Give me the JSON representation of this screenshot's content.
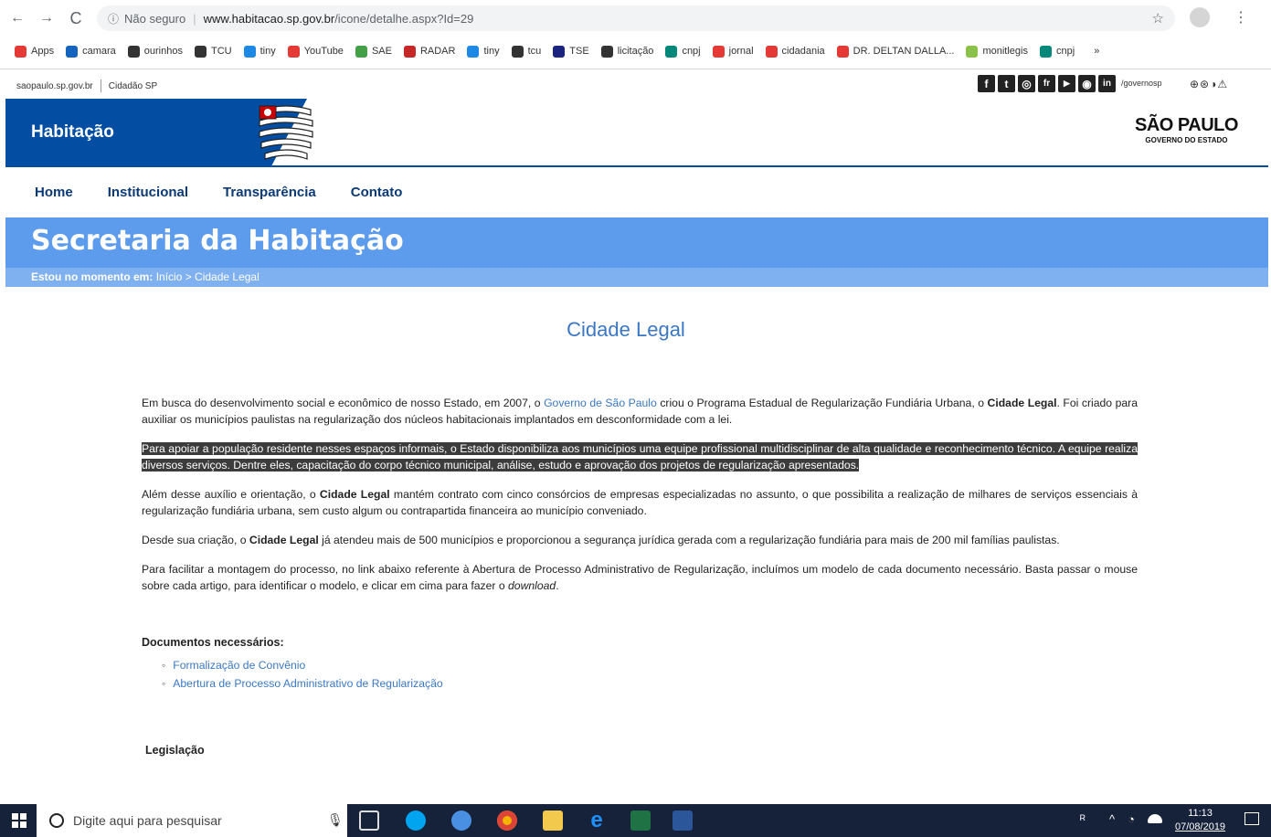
{
  "browser": {
    "info_label": "Não seguro",
    "url_host": "www.habitacao.sp.gov.br",
    "url_path": "/icone/detalhe.aspx?Id=29",
    "bookmarks": [
      "Apps",
      "camara",
      "ourinhos",
      "TCU",
      "tiny",
      "YouTube",
      "SAE",
      "RADAR",
      "tiny",
      "tcu",
      "TSE",
      "licitação",
      "cnpj",
      "jornal",
      "cidadania",
      "DR. DELTAN DALLA...",
      "monitlegis",
      "cnpj"
    ],
    "bookmarks_more": "»"
  },
  "topstrip": {
    "site": "saopaulo.sp.gov.br",
    "citizen": "Cidadão SP",
    "handle": "/governosp"
  },
  "header": {
    "title": "Habitação",
    "logo_text": "SÃO PAULO",
    "logo_sub": "GOVERNO DO ESTADO"
  },
  "nav": [
    "Home",
    "Institucional",
    "Transparência",
    "Contato"
  ],
  "banner": {
    "title": "Secretaria da Habitação",
    "crumb_prefix": "Estou no momento em:",
    "crumb_path": "Início > Cidade Legal"
  },
  "content": {
    "title": "Cidade Legal",
    "p1_a": "Em busca do desenvolvimento social e econômico de nosso Estado, em 2007, o ",
    "p1_link": "Governo de São Paulo",
    "p1_b": " criou o Programa Estadual de Regularização Fundiária Urbana, o ",
    "p1_bold": "Cidade Legal",
    "p1_c": ". Foi criado para auxiliar os municípios paulistas na regularização dos núcleos habitacionais implantados em desconformidade com a lei.",
    "p2": "Para apoiar a população residente nesses espaços informais, o Estado disponibiliza aos municípios uma equipe profissional multidisciplinar de alta qualidade e reconhecimento técnico. A equipe realiza diversos serviços. Dentre eles, capacitação do corpo técnico municipal, análise, estudo e aprovação dos projetos de regularização apresentados.",
    "p3_a": "Além desse auxílio e orientação, o ",
    "p3_bold": "Cidade Legal",
    "p3_b": " mantém contrato com cinco consórcios de empresas especializadas no assunto, o que possibilita a realização de milhares de serviços essenciais à regularização fundiária urbana, sem custo algum ou contrapartida financeira ao município conveniado.",
    "p4_a": "Desde sua criação, o ",
    "p4_bold": "Cidade Legal",
    "p4_b": " já atendeu mais de 500 municípios e proporcionou a segurança jurídica gerada com a regularização fundiária para mais de 200 mil famílias paulistas.",
    "p5_a": "Para facilitar a montagem do processo, no link abaixo referente à Abertura de Processo Administrativo de Regularização, incluímos um modelo de cada documento necessário. Basta passar o mouse sobre cada artigo, para identificar o modelo, e clicar em cima para fazer o ",
    "p5_em": "download",
    "p5_b": ".",
    "docs_heading": "Documentos necessários:",
    "docs": [
      "Formalização de Convênio",
      "Abertura de Processo Administrativo de Regularização"
    ],
    "legis_heading": "Legislação"
  },
  "taskbar": {
    "search_placeholder": "Digite aqui para pesquisar",
    "time": "11:13",
    "date": "07/08/2019"
  }
}
